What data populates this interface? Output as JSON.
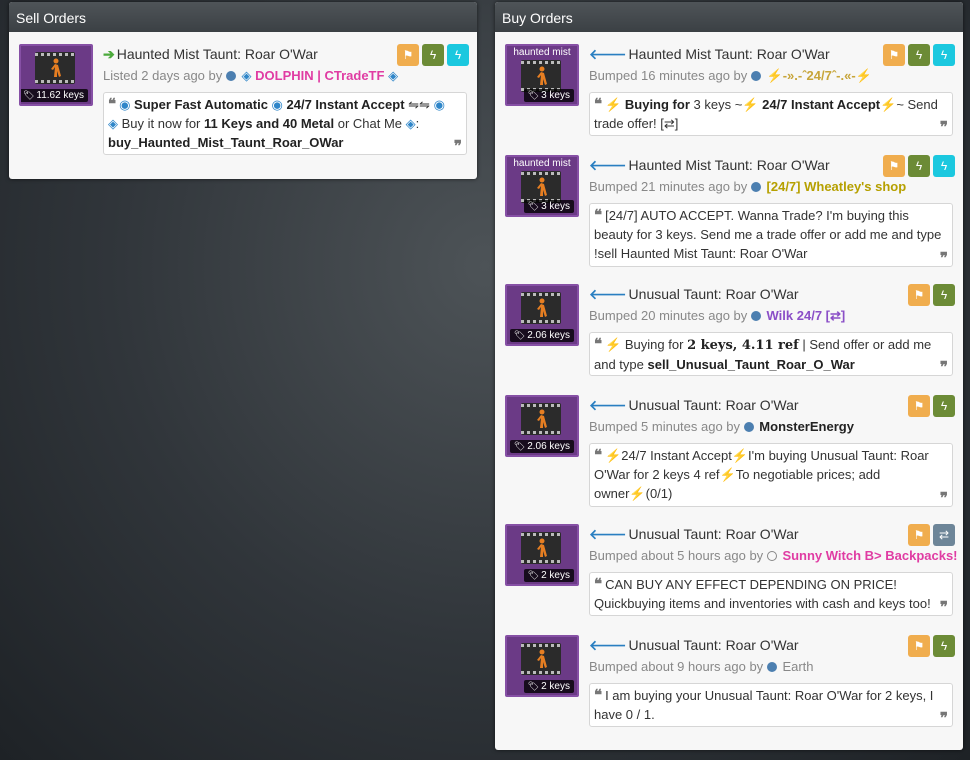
{
  "sell": {
    "title": "Sell Orders",
    "listing": {
      "name": "Haunted Mist Taunt: Roar O'War",
      "price": "11.62 keys",
      "meta_prefix": "Listed 2 days ago by",
      "user": "DOLPHIN | CTradeTF",
      "user_color": "#e03ca3",
      "quote_parts": [
        "Super Fast Automatic",
        "24/7 Instant Accept",
        "⇋⇋",
        "Buy it now for",
        "11 Keys and 40 Metal",
        "or Chat Me",
        ":",
        "buy_Haunted_Mist_Taunt_Roar_OWar"
      ]
    }
  },
  "buy": {
    "title": "Buy Orders",
    "listings": [
      {
        "name": "Haunted Mist Taunt: Roar O'War",
        "quality_label": "haunted mist",
        "price": "3 keys",
        "meta_prefix": "Bumped 16 minutes ago by",
        "user": "-».-ˆ24/7ˆ-.«-",
        "user_color": "#c7a53a",
        "quote": [
          "Buying for",
          "3 keys ~",
          "24/7 Instant Accept",
          "~ Send trade offer! [⇄]"
        ]
      },
      {
        "name": "Haunted Mist Taunt: Roar O'War",
        "quality_label": "haunted mist",
        "price": "3 keys",
        "meta_prefix": "Bumped 21 minutes ago by",
        "user": "[24/7] Wheatley's shop",
        "user_color": "#b6a000",
        "quote": [
          "[24/7] AUTO ACCEPT. Wanna Trade? I'm buying this beauty for 3 keys. Send me a trade offer or add me and type !sell Haunted Mist Taunt: Roar O'War"
        ]
      },
      {
        "name": "Unusual Taunt: Roar O'War",
        "quality_label": "",
        "price": "2.06 keys",
        "meta_prefix": "Bumped 20 minutes ago by",
        "user": "Wilk 24/7 [⇄]",
        "user_color": "#8b4fc7",
        "quote": [
          "Buying for",
          "2 keys, 4.11 ref",
          "| Send offer or add me and type",
          "sell_Unusual_Taunt_Roar_O_War"
        ]
      },
      {
        "name": "Unusual Taunt: Roar O'War",
        "quality_label": "",
        "price": "2.06 keys",
        "meta_prefix": "Bumped 5 minutes ago by",
        "user": "MonsterEnergy",
        "user_color": "#222222",
        "quote": [
          "24/7 Instant Accept",
          "I'm buying Unusual Taunt: Roar O'War for 2 keys 4 ref",
          "To negotiable prices; add owner",
          "(0/1)"
        ]
      },
      {
        "name": "Unusual Taunt: Roar O'War",
        "quality_label": "",
        "price": "2 keys",
        "meta_prefix": "Bumped about 5 hours ago by",
        "user": "Sunny Witch B> Backpacks!",
        "user_color": "#e03ca3",
        "quote": [
          "CAN BUY ANY EFFECT DEPENDING ON PRICE! Quickbuying items and inventories with cash and keys too!"
        ]
      },
      {
        "name": "Unusual Taunt: Roar O'War",
        "quality_label": "",
        "price": "2 keys",
        "meta_prefix": "Bumped about 9 hours ago by",
        "user": "Earth",
        "user_color": "#888888",
        "quote": [
          "I am buying your Unusual Taunt: Roar O'War for 2 keys, I have 0 / 1."
        ]
      }
    ]
  },
  "icons": {
    "flag": "flag-icon",
    "bolt": "lightning-icon",
    "exchange": "exchange-icon",
    "arrow_right": "arrow-right-icon",
    "arrow_left": "arrow-left-icon",
    "tag": "tag-icon",
    "quote_open": "quote-open-icon",
    "quote_close": "quote-close-icon"
  },
  "colors": {
    "orange": "#f0ad4e",
    "green": "#6c8b36",
    "cyan": "#1bc8df",
    "slate": "#6d8598",
    "unusual_purple": "#8650a5"
  }
}
